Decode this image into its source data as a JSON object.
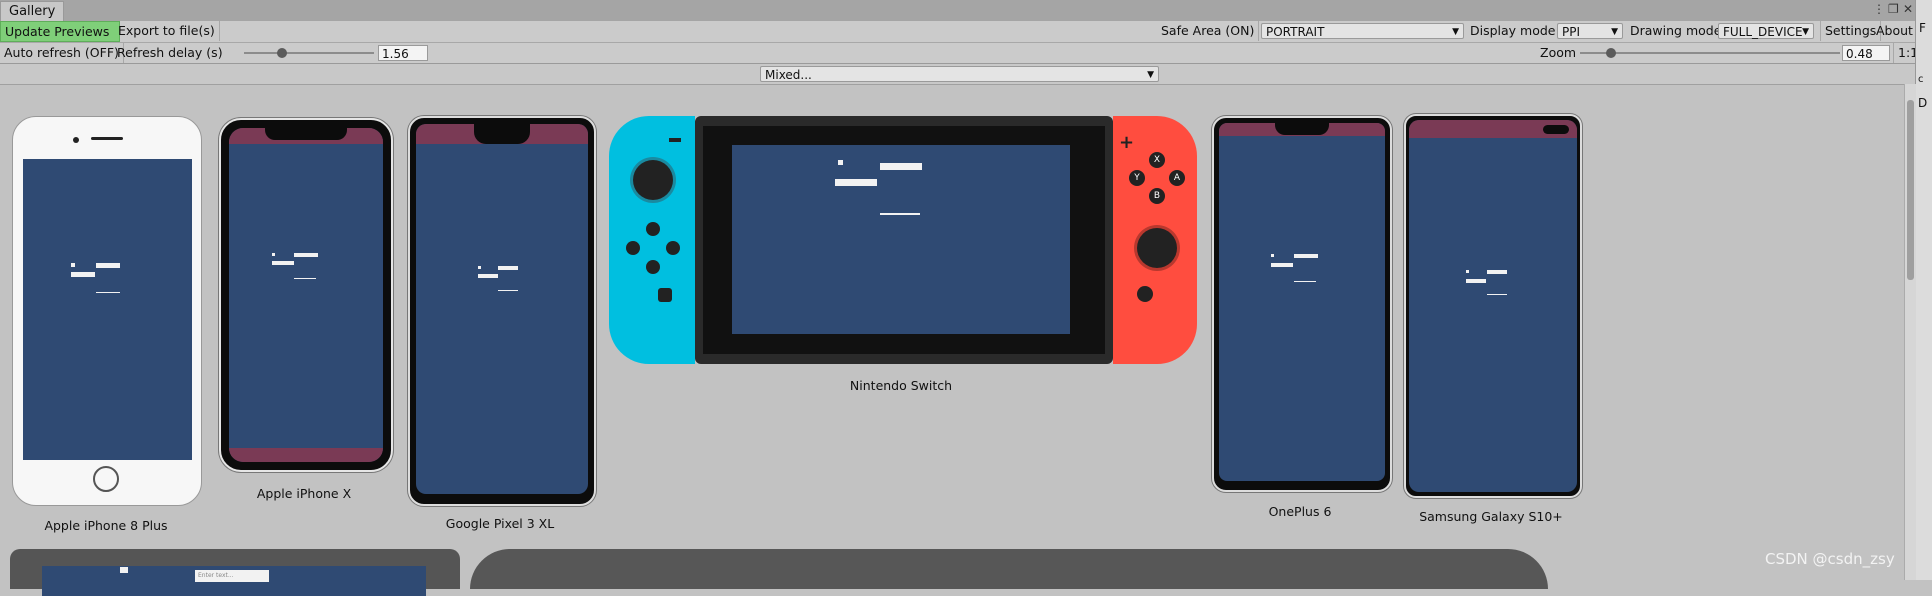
{
  "window": {
    "tab_title": "Gallery"
  },
  "toolbar": {
    "update_previews": "Update Previews",
    "export": "Export to file(s)",
    "safe_area": "Safe Area (ON)",
    "orientation": "PORTRAIT",
    "display_mode_label": "Display mode",
    "display_mode_value": "PPI",
    "drawing_mode_label": "Drawing mode",
    "drawing_mode_value": "FULL_DEVICE",
    "settings": "Settings",
    "about": "About"
  },
  "toolbar2": {
    "auto_refresh": "Auto refresh (OFF)",
    "refresh_delay_label": "Refresh delay (s)",
    "refresh_delay_value": "1.56",
    "refresh_delay_fraction": 0.29,
    "zoom_label": "Zoom",
    "zoom_value": "0.48",
    "zoom_fraction": 0.12,
    "ratio_button": "1:1"
  },
  "filter": {
    "selected": "Mixed..."
  },
  "devices": [
    {
      "name": "Apple iPhone 8 Plus"
    },
    {
      "name": "Apple iPhone X"
    },
    {
      "name": "Google Pixel 3 XL"
    },
    {
      "name": "Nintendo Switch"
    },
    {
      "name": "OnePlus 6"
    },
    {
      "name": "Samsung Galaxy S10+"
    }
  ],
  "preview_ui": {
    "input_placeholder": "Enter text..."
  },
  "side_panel": {
    "letter_top": "F",
    "letter_mid": "D",
    "letter_small": "c"
  },
  "watermark": "CSDN @csdn_zsy",
  "colors": {
    "screen": "#2f4a73",
    "safe_area_band": "#7a3a55",
    "update_button": "#7fcf79",
    "joycon_left": "#00bfe0",
    "joycon_right": "#ff4d3f"
  }
}
